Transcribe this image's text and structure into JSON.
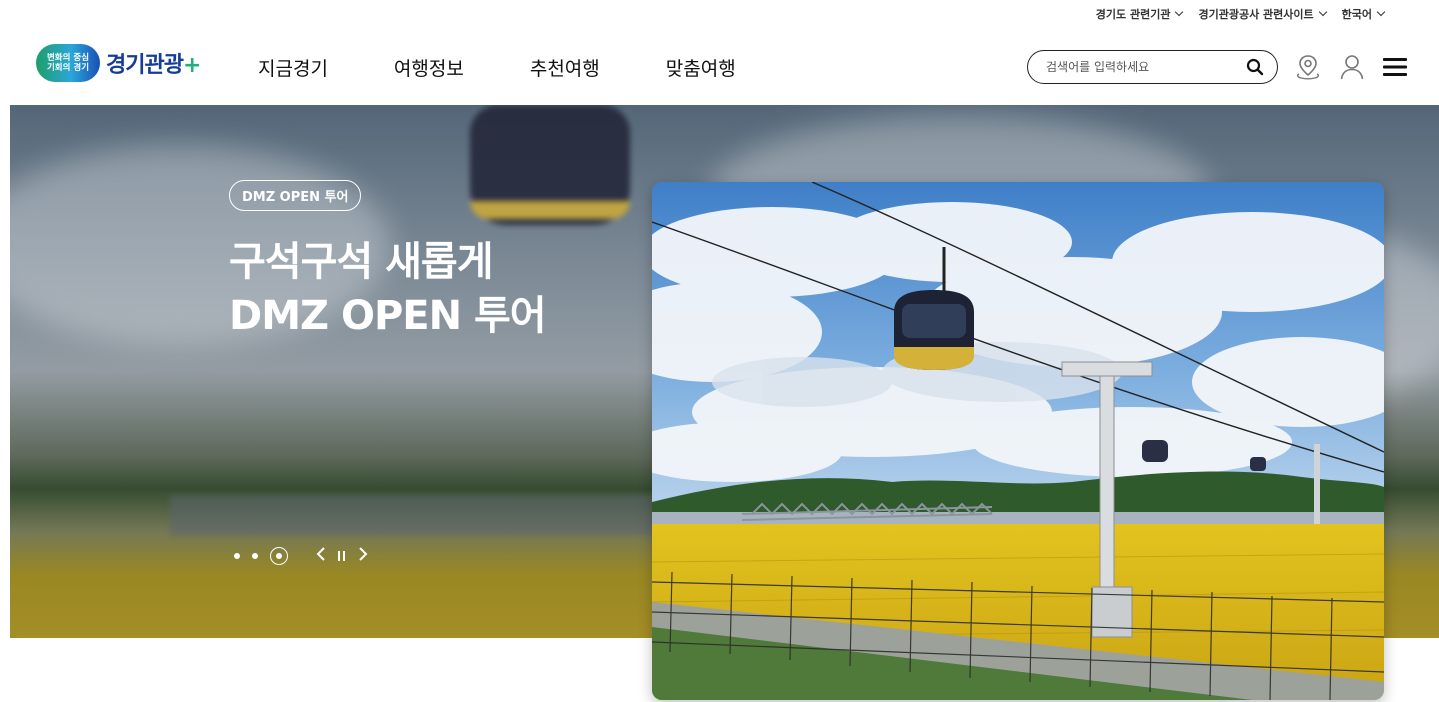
{
  "util_bar": {
    "related_orgs": "경기도 관련기관",
    "related_sites": "경기관광공사 관련사이트",
    "language": "한국어"
  },
  "logo": {
    "badge_line1": "변화의 중심",
    "badge_line2": "기회의 경기",
    "text": "경기관광",
    "suffix": "+"
  },
  "nav": {
    "items": [
      "지금경기",
      "여행정보",
      "추천여행",
      "맞춤여행"
    ]
  },
  "search": {
    "placeholder": "검색어를 입력하세요"
  },
  "hero": {
    "badge": "DMZ OPEN 투어",
    "title_line1": "구석구석 새롭게",
    "title_line2": "DMZ OPEN 투어"
  },
  "colors": {
    "brand_blue": "#163c9a",
    "brand_green": "#22b07a",
    "field_yellow": "#d8b820"
  },
  "icons": [
    "chevron-down-icon",
    "search-icon",
    "location-pin-icon",
    "user-icon",
    "menu-icon",
    "prev-icon",
    "pause-icon",
    "next-icon"
  ]
}
